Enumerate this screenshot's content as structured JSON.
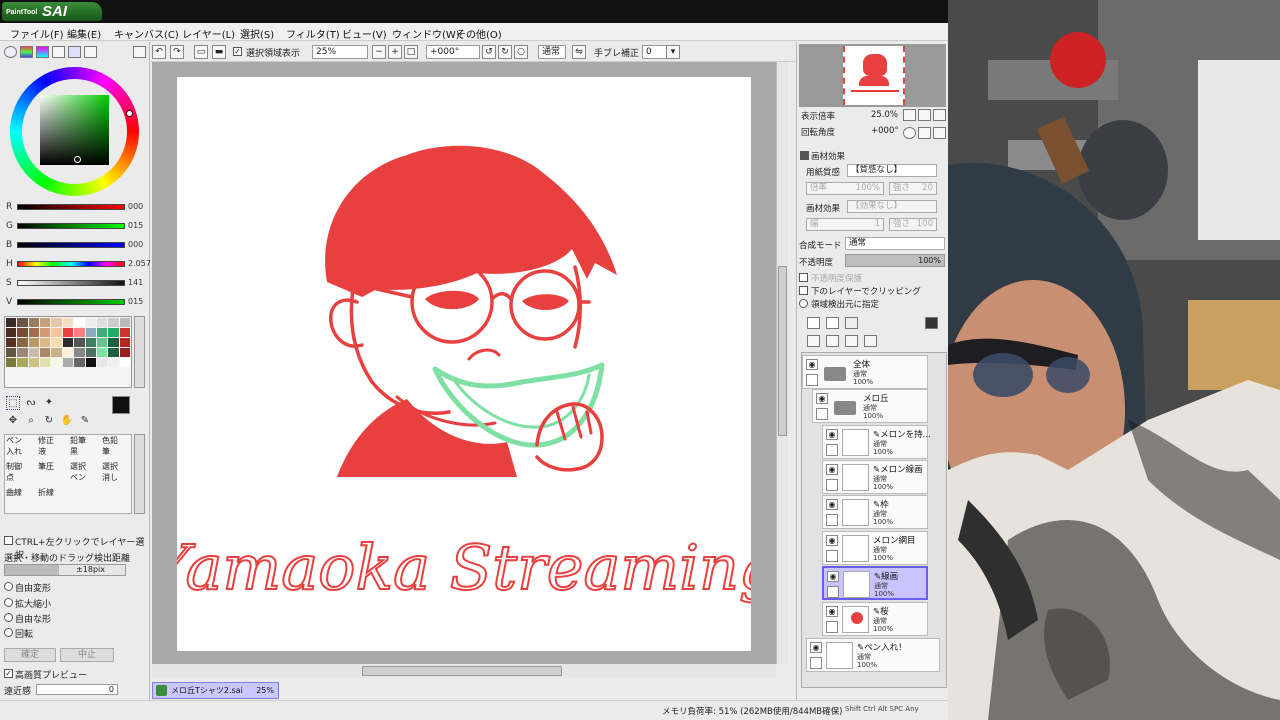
{
  "app": {
    "logo_brand": "PaintTool",
    "logo_name": "SAI"
  },
  "menu": [
    "ファイル(F)",
    "編集(E)",
    "キャンバス(C)",
    "レイヤー(L)",
    "選択(S)",
    "フィルタ(T)",
    "ビュー(V)",
    "ウィンドウ(W)",
    "その他(O)"
  ],
  "toolbar": {
    "show_selection_label": "選択領域表示",
    "zoom": "25%",
    "rotation": "+000°",
    "blend_mode": "通常",
    "stabilizer_label": "手ブレ補正",
    "stabilizer_value": "0"
  },
  "color": {
    "r_label": "R",
    "r_value": "000",
    "g_label": "G",
    "g_value": "015",
    "b_label": "B",
    "b_value": "000",
    "h_label": "H",
    "h_value": "2.057",
    "s_label": "S",
    "s_value": "141",
    "v_label": "V",
    "v_value": "015",
    "current": "#0f0f0f"
  },
  "brushes": [
    {
      "label": "ペン入れ"
    },
    {
      "label": "修正液"
    },
    {
      "label": "鉛筆黒"
    },
    {
      "label": "色鉛筆"
    },
    {
      "label": "制御点"
    },
    {
      "label": "筆圧"
    },
    {
      "label": "選択ペン"
    },
    {
      "label": "選択消し"
    },
    {
      "label": "曲線"
    },
    {
      "label": "折線"
    }
  ],
  "leftoptions": {
    "ctrl_select": "CTRL+左クリックでレイヤー選択",
    "drag_distance_label": "選択・移動のドラッグ検出距離",
    "drag_distance_value": "±18pix",
    "radio_free_transform": "自由変形",
    "radio_scale": "拡大縮小",
    "radio_free_shape": "自由な形",
    "radio_rotate": "回転",
    "confirm": "確定",
    "cancel": "中止",
    "hq_preview": "高画質プレビュー",
    "perspective_label": "遠近感",
    "perspective_value": "0"
  },
  "artwork": {
    "signature": "Yamaoka Streaming",
    "line_color": "#e8403f",
    "melon_color": "#7ee0a2"
  },
  "document": {
    "tab_name": "メロ丘Tシャツ2.sai",
    "tab_zoom": "25%"
  },
  "status": {
    "memory": "メモリ負荷率: 51% (262MB使用/844MB確保)",
    "keys": "Shift Ctrl Alt SPC Any"
  },
  "navigator": {
    "zoom_label": "表示倍率",
    "zoom_value": "25.0%",
    "rotate_label": "回転角度",
    "rotate_value": "+000°"
  },
  "material": {
    "section_title": "画材効果",
    "paper_texture_label": "用紙質感",
    "paper_texture_value": "【質感なし】",
    "scale_label": "倍率",
    "scale_value": "100%",
    "strength_label": "強さ",
    "strength_value": "20",
    "effect_label": "画材効果",
    "effect_value": "【効果なし】",
    "width_label": "幅",
    "width_value": "1",
    "effect_strength_label": "強さ",
    "effect_strength_value": "100"
  },
  "layerprops": {
    "blend_label": "合成モード",
    "blend_value": "通常",
    "opacity_label": "不透明度",
    "opacity_value": "100%",
    "preserve_opacity": "不透明度保護",
    "clip_below": "下のレイヤーでクリッピング",
    "detect_source": "領域検出元に指定"
  },
  "layers": [
    {
      "name": "全体",
      "mode": "通常",
      "opacity": "100%",
      "type": "folder"
    },
    {
      "name": "メロ丘",
      "mode": "通常",
      "opacity": "100%",
      "type": "folder"
    },
    {
      "name": "メロンを持...",
      "mode": "通常",
      "opacity": "100%",
      "type": "layer"
    },
    {
      "name": "メロン線画",
      "mode": "通常",
      "opacity": "100%",
      "type": "layer"
    },
    {
      "name": "枠",
      "mode": "通常",
      "opacity": "100%",
      "type": "layer"
    },
    {
      "name": "メロン網目",
      "mode": "通常",
      "opacity": "100%",
      "type": "layer"
    },
    {
      "name": "線画",
      "mode": "通常",
      "opacity": "100%",
      "type": "layer",
      "selected": true
    },
    {
      "name": "桜",
      "mode": "通常",
      "opacity": "100%",
      "type": "layer"
    },
    {
      "name": "ペン入れ！",
      "mode": "通常",
      "opacity": "100%",
      "type": "layer"
    }
  ]
}
